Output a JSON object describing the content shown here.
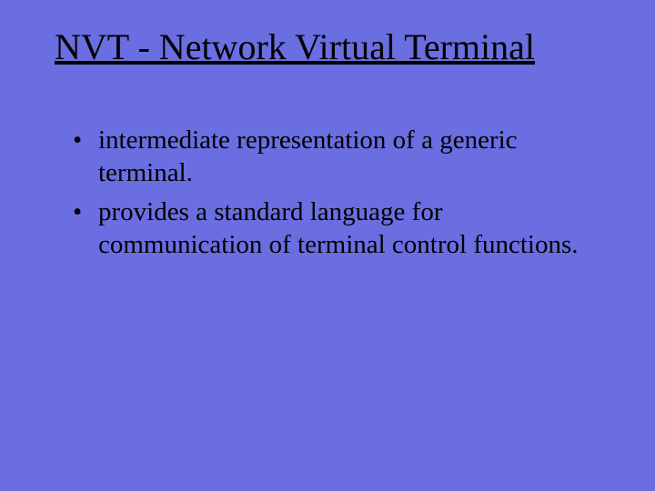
{
  "slide": {
    "title": "NVT - Network Virtual Terminal",
    "bullets": [
      "intermediate representation of a generic terminal.",
      "provides a standard language for communication of terminal control functions."
    ]
  }
}
